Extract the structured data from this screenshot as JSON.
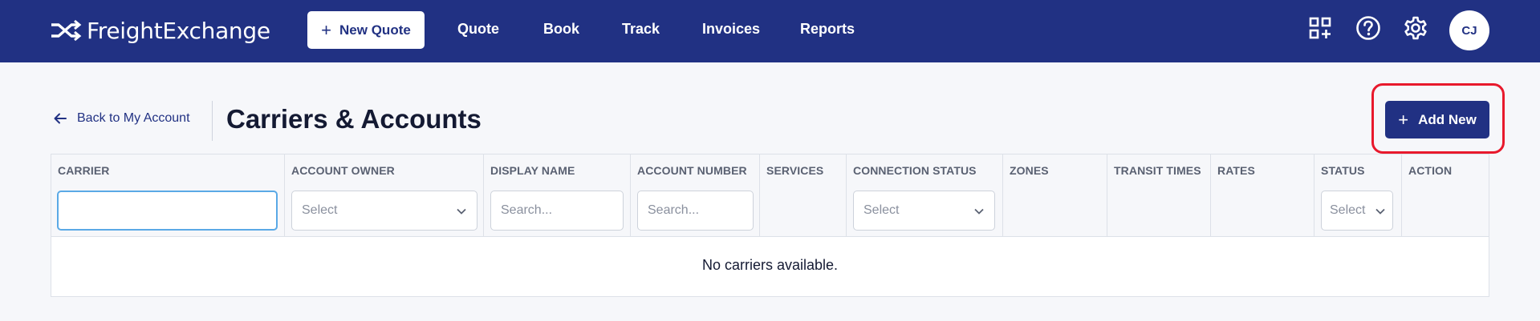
{
  "brand": {
    "name": "FreightExchange",
    "icon": "shuffle-arrows-logo"
  },
  "topnav": {
    "new_quote_label": "New Quote",
    "links": [
      "Quote",
      "Book",
      "Track",
      "Invoices",
      "Reports"
    ],
    "icons": [
      "apps-add-icon",
      "help-icon",
      "settings-gear-icon"
    ],
    "avatar_initials": "CJ"
  },
  "header": {
    "back_label": "Back to My Account",
    "title": "Carriers & Accounts",
    "add_new_label": "Add New"
  },
  "table": {
    "columns": [
      {
        "label": "CARRIER",
        "filter": {
          "kind": "text",
          "value": "",
          "placeholder": ""
        }
      },
      {
        "label": "ACCOUNT OWNER",
        "filter": {
          "kind": "select",
          "value": "Select"
        }
      },
      {
        "label": "DISPLAY NAME",
        "filter": {
          "kind": "text",
          "value": "",
          "placeholder": "Search..."
        }
      },
      {
        "label": "ACCOUNT NUMBER",
        "filter": {
          "kind": "text",
          "value": "",
          "placeholder": "Search..."
        }
      },
      {
        "label": "SERVICES"
      },
      {
        "label": "CONNECTION STATUS",
        "filter": {
          "kind": "select",
          "value": "Select"
        }
      },
      {
        "label": "ZONES"
      },
      {
        "label": "TRANSIT TIMES"
      },
      {
        "label": "RATES"
      },
      {
        "label": "STATUS",
        "filter": {
          "kind": "select",
          "value": "Select"
        }
      },
      {
        "label": "ACTION"
      }
    ],
    "empty_message": "No carriers available."
  },
  "colors": {
    "nav_bg": "#213183",
    "primary": "#213183",
    "highlight": "#e8192c",
    "focus_border": "#5aa9e6"
  }
}
